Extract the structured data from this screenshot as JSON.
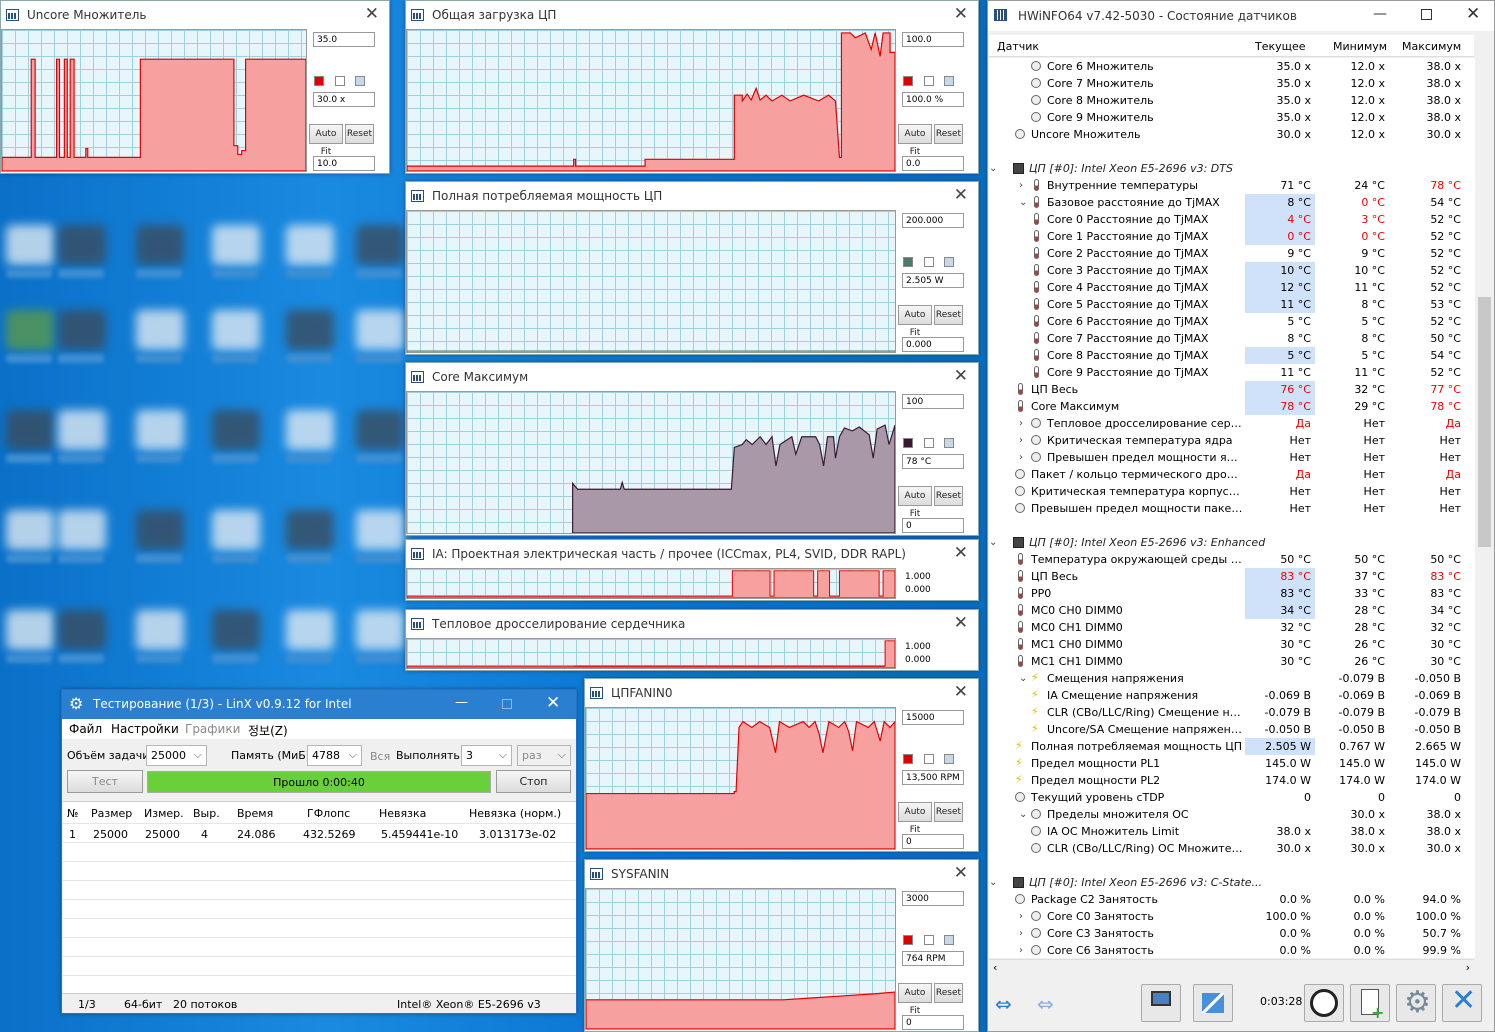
{
  "graphs": [
    {
      "title": "Uncore Множитель",
      "max": "35.0",
      "cur": "30.0 x",
      "min": "10.0",
      "colors": [
        "#e00000",
        "#fff",
        "#c8d8ea"
      ]
    },
    {
      "title": "Общая загрузка ЦП",
      "max": "100.0",
      "cur": "100.0 %",
      "min": "0.0",
      "colors": [
        "#e00000",
        "#fff",
        "#c8d8ea"
      ]
    },
    {
      "title": "Полная потребляемая мощность ЦП",
      "max": "200.000",
      "cur": "2.505 W",
      "min": "0.000",
      "colors": [
        "#4a7a6a",
        "#fff",
        "#c8d8ea"
      ]
    },
    {
      "title": "Core Максимум",
      "max": "100",
      "cur": "78 °C",
      "min": "0",
      "colors": [
        "#3a1830",
        "#fff",
        "#c8d8ea"
      ]
    },
    {
      "title": "IA: Проектная электрическая часть / прочее (ICCmax, PL4, SVID, DDR RAPL)",
      "max": "1.000",
      "min": "0.000"
    },
    {
      "title": "Тепловое дросселирование сердечника",
      "max": "1.000",
      "min": "0.000"
    },
    {
      "title": "ЦПFANIN0",
      "max": "15000",
      "cur": "13,500 RPM",
      "min": "0",
      "colors": [
        "#e00000",
        "#fff",
        "#c8d8ea"
      ]
    },
    {
      "title": "SYSFANIN",
      "max": "3000",
      "cur": "764 RPM",
      "min": "0",
      "colors": [
        "#e00000",
        "#fff",
        "#c8d8ea"
      ]
    }
  ],
  "buttons": {
    "autofit": "Auto Fit",
    "reset": "Reset"
  },
  "hwinfo": {
    "title": "HWiNFO64 v7.42-5030 - Состояние датчиков",
    "cols": [
      "Датчик",
      "Текущее",
      "Минимум",
      "Максимум"
    ],
    "rows": [
      {
        "n": "Core 6 Множитель",
        "i": 2,
        "k": "r",
        "v": [
          "35.0 x",
          "12.0 x",
          "38.0 x"
        ]
      },
      {
        "n": "Core 7 Множитель",
        "i": 2,
        "k": "r",
        "v": [
          "35.0 x",
          "12.0 x",
          "38.0 x"
        ]
      },
      {
        "n": "Core 8 Множитель",
        "i": 2,
        "k": "r",
        "v": [
          "35.0 x",
          "12.0 x",
          "38.0 x"
        ]
      },
      {
        "n": "Core 9 Множитель",
        "i": 2,
        "k": "r",
        "v": [
          "35.0 x",
          "12.0 x",
          "38.0 x"
        ]
      },
      {
        "n": "Uncore Множитель",
        "i": 1,
        "k": "r",
        "v": [
          "30.0 x",
          "12.0 x",
          "30.0 x"
        ]
      },
      {
        "n": "",
        "i": 0,
        "k": "blank",
        "v": [
          "",
          "",
          ""
        ]
      },
      {
        "n": "ЦП [#0]: Intel Xeon E5-2696 v3: DTS",
        "i": 0,
        "k": "sec",
        "e": "⌄",
        "v": [
          "",
          "",
          ""
        ]
      },
      {
        "n": "Внутренние температуры",
        "i": 2,
        "k": "t",
        "e": "›",
        "v": [
          "71 °C",
          "24 °C",
          "78 °C"
        ],
        "r": [
          0,
          0,
          1
        ]
      },
      {
        "n": "Базовое расстояние до TjMAX",
        "i": 2,
        "k": "t",
        "e": "⌄",
        "v": [
          "8 °C",
          "0 °C",
          "54 °C"
        ],
        "h": 1,
        "r": [
          0,
          1,
          0
        ]
      },
      {
        "n": "Core 0 Расстояние до TjMAX",
        "i": 2,
        "k": "t",
        "v": [
          "4 °C",
          "3 °C",
          "52 °C"
        ],
        "h": 1,
        "r": [
          1,
          1,
          0
        ]
      },
      {
        "n": "Core 1 Расстояние до TjMAX",
        "i": 2,
        "k": "t",
        "v": [
          "0 °C",
          "0 °C",
          "52 °C"
        ],
        "h": 1,
        "r": [
          1,
          1,
          0
        ]
      },
      {
        "n": "Core 2 Расстояние до TjMAX",
        "i": 2,
        "k": "t",
        "v": [
          "9 °C",
          "9 °C",
          "52 °C"
        ]
      },
      {
        "n": "Core 3 Расстояние до TjMAX",
        "i": 2,
        "k": "t",
        "v": [
          "10 °C",
          "10 °C",
          "52 °C"
        ],
        "h": 1
      },
      {
        "n": "Core 4 Расстояние до TjMAX",
        "i": 2,
        "k": "t",
        "v": [
          "12 °C",
          "11 °C",
          "52 °C"
        ],
        "h": 1
      },
      {
        "n": "Core 5 Расстояние до TjMAX",
        "i": 2,
        "k": "t",
        "v": [
          "11 °C",
          "8 °C",
          "53 °C"
        ],
        "h": 1
      },
      {
        "n": "Core 6 Расстояние до TjMAX",
        "i": 2,
        "k": "t",
        "v": [
          "5 °C",
          "5 °C",
          "52 °C"
        ]
      },
      {
        "n": "Core 7 Расстояние до TjMAX",
        "i": 2,
        "k": "t",
        "v": [
          "8 °C",
          "8 °C",
          "50 °C"
        ]
      },
      {
        "n": "Core 8 Расстояние до TjMAX",
        "i": 2,
        "k": "t",
        "v": [
          "5 °C",
          "5 °C",
          "54 °C"
        ],
        "h": 1
      },
      {
        "n": "Core 9 Расстояние до TjMAX",
        "i": 2,
        "k": "t",
        "v": [
          "11 °C",
          "11 °C",
          "52 °C"
        ]
      },
      {
        "n": "ЦП Весь",
        "i": 1,
        "k": "t",
        "v": [
          "76 °C",
          "32 °C",
          "77 °C"
        ],
        "h": 1,
        "r": [
          1,
          0,
          1
        ]
      },
      {
        "n": "Core Максимум",
        "i": 1,
        "k": "t",
        "v": [
          "78 °C",
          "29 °C",
          "78 °C"
        ],
        "h": 1,
        "r": [
          1,
          0,
          1
        ]
      },
      {
        "n": "Тепловое дросселирование сердеч...",
        "i": 2,
        "k": "r",
        "e": "›",
        "v": [
          "Да",
          "Нет",
          "Да"
        ],
        "r": [
          1,
          0,
          1
        ]
      },
      {
        "n": "Критическая температура ядра",
        "i": 2,
        "k": "r",
        "e": "›",
        "v": [
          "Нет",
          "Нет",
          "Нет"
        ]
      },
      {
        "n": "Превышен предел мощности ядра",
        "i": 2,
        "k": "r",
        "e": "›",
        "v": [
          "Нет",
          "Нет",
          "Нет"
        ]
      },
      {
        "n": "Пакет / кольцо термического дроссел...",
        "i": 1,
        "k": "r",
        "v": [
          "Да",
          "Нет",
          "Да"
        ],
        "r": [
          1,
          0,
          1
        ]
      },
      {
        "n": "Критическая температура корпуса / к...",
        "i": 1,
        "k": "r",
        "v": [
          "Нет",
          "Нет",
          "Нет"
        ]
      },
      {
        "n": "Превышен предел мощности пакета / ...",
        "i": 1,
        "k": "r",
        "v": [
          "Нет",
          "Нет",
          "Нет"
        ]
      },
      {
        "n": "",
        "i": 0,
        "k": "blank",
        "v": [
          "",
          "",
          ""
        ]
      },
      {
        "n": "ЦП [#0]: Intel Xeon E5-2696 v3: Enhanced",
        "i": 0,
        "k": "sec",
        "e": "⌄",
        "v": [
          "",
          "",
          ""
        ]
      },
      {
        "n": "Температура окружающей среды памяти",
        "i": 1,
        "k": "t",
        "v": [
          "50 °C",
          "50 °C",
          "50 °C"
        ]
      },
      {
        "n": "ЦП Весь",
        "i": 1,
        "k": "t",
        "v": [
          "83 °C",
          "37 °C",
          "83 °C"
        ],
        "h": 1,
        "r": [
          1,
          0,
          1
        ]
      },
      {
        "n": "PP0",
        "i": 1,
        "k": "t",
        "v": [
          "83 °C",
          "33 °C",
          "83 °C"
        ],
        "h": 1
      },
      {
        "n": "MC0 CH0 DIMM0",
        "i": 1,
        "k": "t",
        "v": [
          "34 °C",
          "28 °C",
          "34 °C"
        ],
        "h": 1
      },
      {
        "n": "MC0 CH1 DIMM0",
        "i": 1,
        "k": "t",
        "v": [
          "32 °C",
          "28 °C",
          "32 °C"
        ]
      },
      {
        "n": "MC1 CH0 DIMM0",
        "i": 1,
        "k": "t",
        "v": [
          "30 °C",
          "26 °C",
          "30 °C"
        ]
      },
      {
        "n": "MC1 CH1 DIMM0",
        "i": 1,
        "k": "t",
        "v": [
          "30 °C",
          "26 °C",
          "30 °C"
        ]
      },
      {
        "n": "Смещения напряжения",
        "i": 2,
        "k": "v",
        "e": "⌄",
        "v": [
          "",
          "-0.079 В",
          "-0.050 В"
        ]
      },
      {
        "n": "IA Смещение напряжения",
        "i": 2,
        "k": "v",
        "v": [
          "-0.069 В",
          "-0.069 В",
          "-0.069 В"
        ]
      },
      {
        "n": "CLR (CBo/LLC/Ring) Смещение напря...",
        "i": 2,
        "k": "v",
        "v": [
          "-0.079 В",
          "-0.079 В",
          "-0.079 В"
        ]
      },
      {
        "n": "Uncore/SA Смещение напряжения",
        "i": 2,
        "k": "v",
        "v": [
          "-0.050 В",
          "-0.050 В",
          "-0.050 В"
        ]
      },
      {
        "n": "Полная потребляемая мощность ЦП",
        "i": 1,
        "k": "v",
        "v": [
          "2.505 W",
          "0.767 W",
          "2.665 W"
        ],
        "h": 1
      },
      {
        "n": "Предел мощности PL1",
        "i": 1,
        "k": "v",
        "v": [
          "145.0 W",
          "145.0 W",
          "145.0 W"
        ]
      },
      {
        "n": "Предел мощности PL2",
        "i": 1,
        "k": "v",
        "v": [
          "174.0 W",
          "174.0 W",
          "174.0 W"
        ]
      },
      {
        "n": "Текущий уровень cTDP",
        "i": 1,
        "k": "r",
        "v": [
          "0",
          "0",
          "0"
        ]
      },
      {
        "n": "Пределы множителя OC",
        "i": 2,
        "k": "r",
        "e": "⌄",
        "v": [
          "",
          "30.0 x",
          "38.0 x"
        ]
      },
      {
        "n": "IA OC Множитель Limit",
        "i": 2,
        "k": "r",
        "v": [
          "38.0 x",
          "38.0 x",
          "38.0 x"
        ]
      },
      {
        "n": "CLR (CBo/LLC/Ring) OC Множитель L...",
        "i": 2,
        "k": "r",
        "v": [
          "30.0 x",
          "30.0 x",
          "30.0 x"
        ]
      },
      {
        "n": "",
        "i": 0,
        "k": "blank",
        "v": [
          "",
          "",
          ""
        ]
      },
      {
        "n": "ЦП [#0]: Intel Xeon E5-2696 v3: C-State...",
        "i": 0,
        "k": "sec",
        "e": "⌄",
        "v": [
          "",
          "",
          ""
        ]
      },
      {
        "n": "Package C2 Занятость",
        "i": 1,
        "k": "r",
        "v": [
          "0.0 %",
          "0.0 %",
          "94.0 %"
        ]
      },
      {
        "n": "Core C0 Занятость",
        "i": 2,
        "k": "r",
        "e": "›",
        "v": [
          "100.0 %",
          "0.0 %",
          "100.0 %"
        ]
      },
      {
        "n": "Core C3 Занятость",
        "i": 2,
        "k": "r",
        "e": "›",
        "v": [
          "0.0 %",
          "0.0 %",
          "50.7 %"
        ]
      },
      {
        "n": "Core C6 Занятость",
        "i": 2,
        "k": "r",
        "e": "›",
        "v": [
          "0.0 %",
          "0.0 %",
          "99.9 %"
        ]
      }
    ],
    "timer": "0:03:28"
  },
  "linx": {
    "title": "Тестирование (1/3) - LinX v0.9.12 for Intel",
    "menu": [
      "Файл",
      "Настройки",
      "Графики",
      "정보(Z)"
    ],
    "size_label": "Объём задачи:",
    "size": "25000",
    "mem_label": "Память (МиБ):",
    "mem": "4788",
    "all": "Вся",
    "run_label": "Выполнять:",
    "run": "3",
    "times": "раз",
    "test_btn": "Тест",
    "progress": "Прошло 0:00:40",
    "stop_btn": "Стоп",
    "progress_frac": 1.0,
    "headers": [
      "№",
      "Размер",
      "Измер.",
      "Выр.",
      "Время",
      "ГФлопс",
      "Невязка",
      "Невязка (норм.)"
    ],
    "row": [
      "1",
      "25000",
      "25000",
      "4",
      "24.086",
      "432.5269",
      "5.459441e-10",
      "3.013173e-02"
    ],
    "status": [
      "1/3",
      "64-бит",
      "20 потоков",
      "Intel® Xeon® E5-2696 v3"
    ]
  }
}
